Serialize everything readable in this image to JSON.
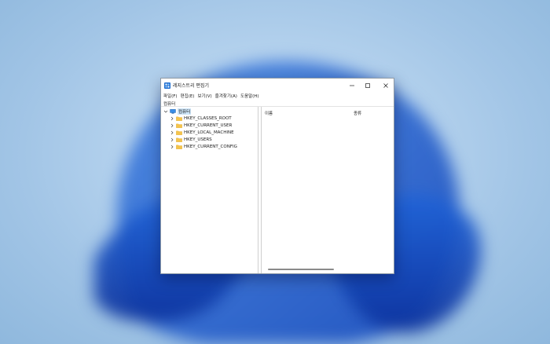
{
  "window": {
    "title": "레지스트리 편집기",
    "controls": [
      "minimize-icon",
      "maximize-icon",
      "close-icon"
    ]
  },
  "menu": {
    "items": [
      "파일(F)",
      "편집(E)",
      "보기(V)",
      "즐겨찾기(A)",
      "도움말(H)"
    ]
  },
  "address": {
    "path": "컴퓨터"
  },
  "tree": {
    "root": "컴퓨터",
    "keys": [
      "HKEY_CLASSES_ROOT",
      "HKEY_CURRENT_USER",
      "HKEY_LOCAL_MACHINE",
      "HKEY_USERS",
      "HKEY_CURRENT_CONFIG"
    ]
  },
  "list": {
    "columns": [
      "이름",
      "종류"
    ]
  },
  "colors": {
    "accent": "#0067c0",
    "selection": "#cce4f7",
    "folder": "#f5c44c"
  }
}
